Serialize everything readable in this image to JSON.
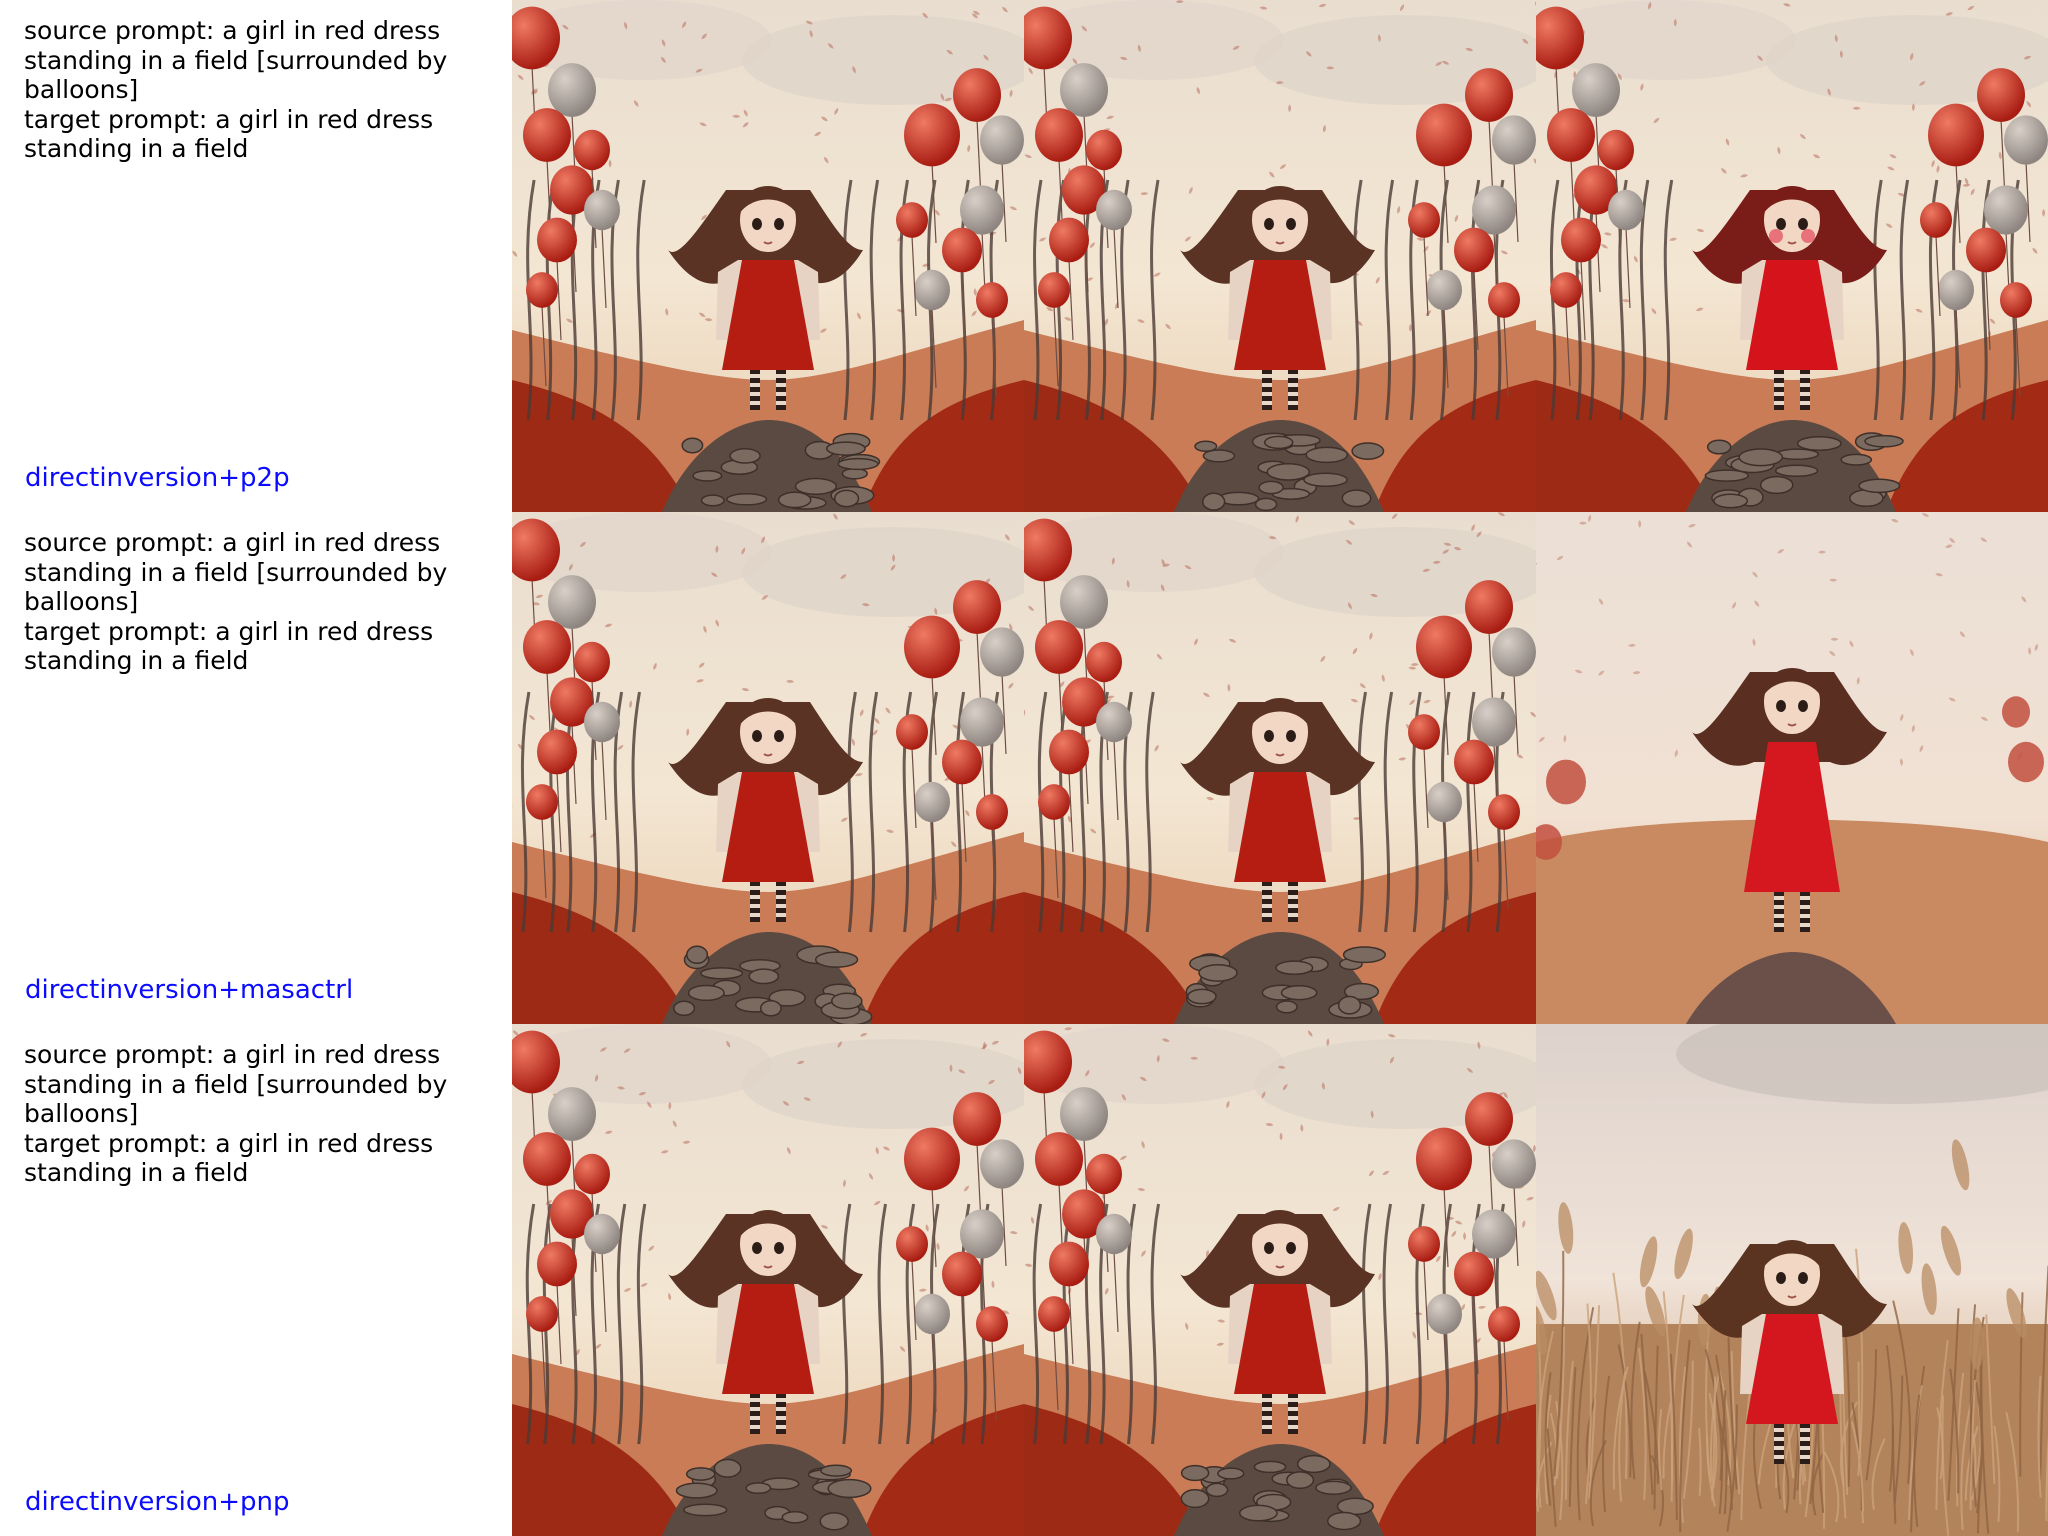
{
  "rows": [
    {
      "source_prompt": "source prompt: a girl in red dress standing in a field [surrounded by balloons]",
      "target_prompt": "target prompt: a girl in red dress standing in a field",
      "method": "directinversion+p2p",
      "images": [
        {
          "variant": "balloons",
          "hair_color": "#5a3324",
          "dress_color": "#b51d12",
          "blush": false
        },
        {
          "variant": "balloons",
          "hair_color": "#5a3324",
          "dress_color": "#b51d12",
          "blush": false
        },
        {
          "variant": "balloons-redder",
          "hair_color": "#7a1d18",
          "dress_color": "#d4131a",
          "blush": true
        }
      ]
    },
    {
      "source_prompt": "source prompt: a girl in red dress standing in a field [surrounded by balloons]",
      "target_prompt": "target prompt: a girl in red dress standing in a field",
      "method": "directinversion+masactrl",
      "images": [
        {
          "variant": "balloons",
          "hair_color": "#5a3324",
          "dress_color": "#b51d12",
          "blush": false
        },
        {
          "variant": "balloons",
          "hair_color": "#5a3324",
          "dress_color": "#b51d12",
          "blush": false
        },
        {
          "variant": "field-long-dress",
          "hair_color": "#5b2e22",
          "dress_color": "#d51820",
          "blush": false
        }
      ]
    },
    {
      "source_prompt": "source prompt: a girl in red dress standing in a field [surrounded by balloons]",
      "target_prompt": "target prompt: a girl in red dress standing in a field",
      "method": "directinversion+pnp",
      "images": [
        {
          "variant": "balloons",
          "hair_color": "#5a3324",
          "dress_color": "#b51d12",
          "blush": false
        },
        {
          "variant": "balloons",
          "hair_color": "#5a3324",
          "dress_color": "#b51d12",
          "blush": false
        },
        {
          "variant": "photo-grass-field",
          "hair_color": "#5b3321",
          "dress_color": "#d4161f",
          "blush": false
        }
      ]
    }
  ],
  "colors": {
    "method_label": "#0b0bff",
    "prompt_text": "#000000",
    "background": "#ffffff"
  }
}
